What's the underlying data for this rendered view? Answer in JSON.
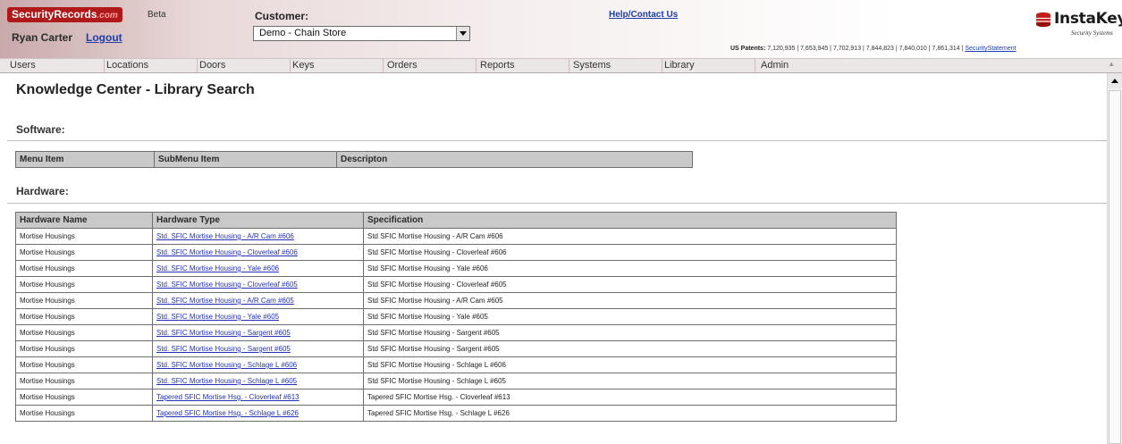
{
  "header": {
    "brand": "SecurityRecords",
    "brand_suffix": ".com",
    "beta": "Beta",
    "user_name": "Ryan Carter",
    "logout_label": "Logout",
    "customer_label": "Customer:",
    "customer_value": "Demo - Chain Store",
    "help_label": "Help/Contact Us",
    "patents_label": "US Patents:",
    "patents_numbers": "7,120,935 | 7,653,945 | 7,702,913 | 7,844,823 | 7,840,010 | 7,861,314",
    "security_statement": "SecurityStatement",
    "logo_word": "InstaKey",
    "logo_sub": "Security Systems"
  },
  "nav": {
    "items": [
      "Users",
      "Locations",
      "Doors",
      "Keys",
      "Orders",
      "Reports",
      "Systems",
      "Library",
      "Admin"
    ]
  },
  "page": {
    "title": "Knowledge Center - Library Search",
    "software_label": "Software:",
    "hardware_label": "Hardware:"
  },
  "software_table": {
    "columns": [
      "Menu Item",
      "SubMenu Item",
      "Descripton"
    ]
  },
  "hardware_table": {
    "columns": [
      "Hardware Name",
      "Hardware Type",
      "Specification"
    ],
    "rows": [
      {
        "name": "Mortise Housings",
        "type": "Std. SFIC Mortise Housing - A/R Cam #606",
        "spec": "Std SFIC Mortise Housing - A/R Cam #606"
      },
      {
        "name": "Mortise Housings",
        "type": "Std. SFIC Mortise Housing - Cloverleaf #606",
        "spec": "Std SFIC Mortise Housing - Cloverleaf #606"
      },
      {
        "name": "Mortise Housings",
        "type": "Std. SFIC Mortise Housing - Yale #606",
        "spec": "Std SFIC Mortise Housing - Yale #606"
      },
      {
        "name": "Mortise Housings",
        "type": "Std. SFIC Mortise Housing - Cloverleaf #605",
        "spec": "Std SFIC Mortise Housing - Cloverleaf #605"
      },
      {
        "name": "Mortise Housings",
        "type": "Std. SFIC Mortise Housing - A/R Cam #605",
        "spec": "Std SFIC Mortise Housing - A/R Cam #605"
      },
      {
        "name": "Mortise Housings",
        "type": "Std. SFIC Mortise Housing - Yale #605",
        "spec": "Std SFIC Mortise Housing - Yale #605"
      },
      {
        "name": "Mortise Housings",
        "type": "Std. SFIC Mortise Housing - Sargent #605",
        "spec": "Std SFIC Mortise Housing - Sargent #605"
      },
      {
        "name": "Mortise Housings",
        "type": "Std. SFIC Mortise Housing - Sargent #605",
        "spec": "Std SFIC Mortise Housing - Sargent #605"
      },
      {
        "name": "Mortise Housings",
        "type": "Std. SFIC Mortise Housing - Schlage L #606",
        "spec": "Std SFIC Mortise Housing - Schlage L #606"
      },
      {
        "name": "Mortise Housings",
        "type": "Std. SFIC Mortise Housing - Schlage L #605",
        "spec": "Std SFIC Mortise Housing - Schlage L #605"
      },
      {
        "name": "Mortise Housings",
        "type": "Tapered SFIC Mortise Hsg. - Cloverleaf #613",
        "spec": "Tapered SFIC Mortise Hsg. - Cloverleaf #613"
      },
      {
        "name": "Mortise Housings",
        "type": "Tapered SFIC Mortise Hsg. - Schlage L #626",
        "spec": "Tapered SFIC Mortise Hsg. - Schlage L #626"
      }
    ]
  }
}
